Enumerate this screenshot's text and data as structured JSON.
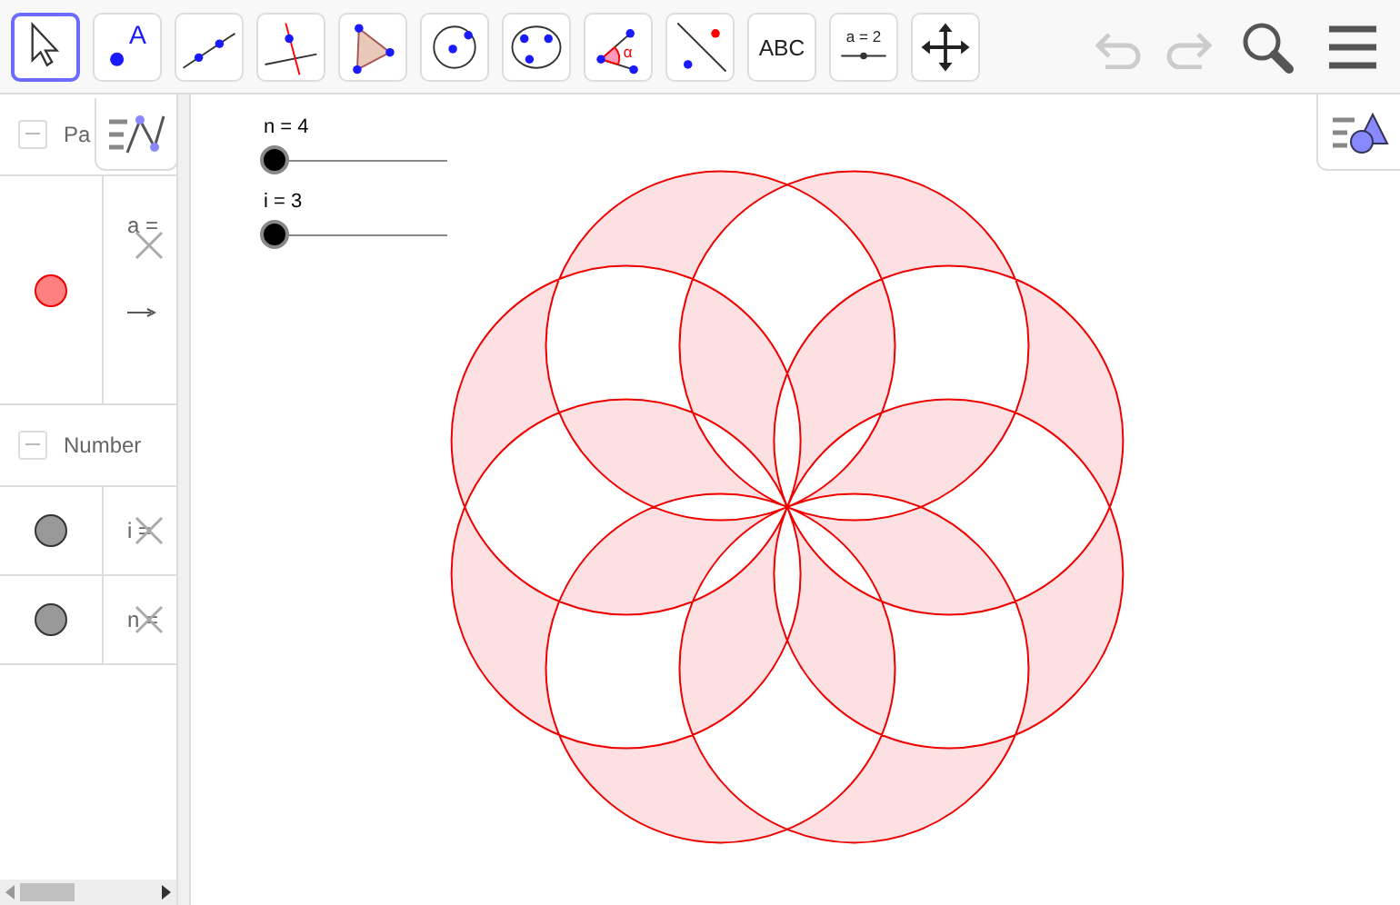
{
  "toolbar": {
    "tools": [
      {
        "kind": "move",
        "selected": true
      },
      {
        "kind": "point",
        "label": "A",
        "selected": false
      },
      {
        "kind": "line",
        "selected": false
      },
      {
        "kind": "perpendicular",
        "selected": false
      },
      {
        "kind": "polygon",
        "selected": false
      },
      {
        "kind": "circle",
        "selected": false
      },
      {
        "kind": "conic",
        "selected": false
      },
      {
        "kind": "angle",
        "label": "α",
        "selected": false
      },
      {
        "kind": "reflect",
        "selected": false
      },
      {
        "kind": "text",
        "label": "ABC",
        "selected": false
      },
      {
        "kind": "slider",
        "label": "a = 2",
        "selected": false
      },
      {
        "kind": "pan",
        "selected": false
      }
    ],
    "undo": {
      "disabled": true
    },
    "redo": {
      "disabled": true
    }
  },
  "algebra": {
    "groups": [
      {
        "title": "Pa",
        "expanded": true,
        "items": [
          {
            "text": "a =",
            "color": "#ff8080",
            "tall": true
          }
        ]
      },
      {
        "title": "Number",
        "expanded": true,
        "items": [
          {
            "text": "i =",
            "color": "#999999",
            "tall": false
          },
          {
            "text": "n =",
            "color": "#999999",
            "tall": false
          }
        ]
      }
    ]
  },
  "graphics": {
    "sliders": [
      {
        "label": "n = 4",
        "level": 0
      },
      {
        "label": "i = 3",
        "level": 0
      }
    ]
  }
}
